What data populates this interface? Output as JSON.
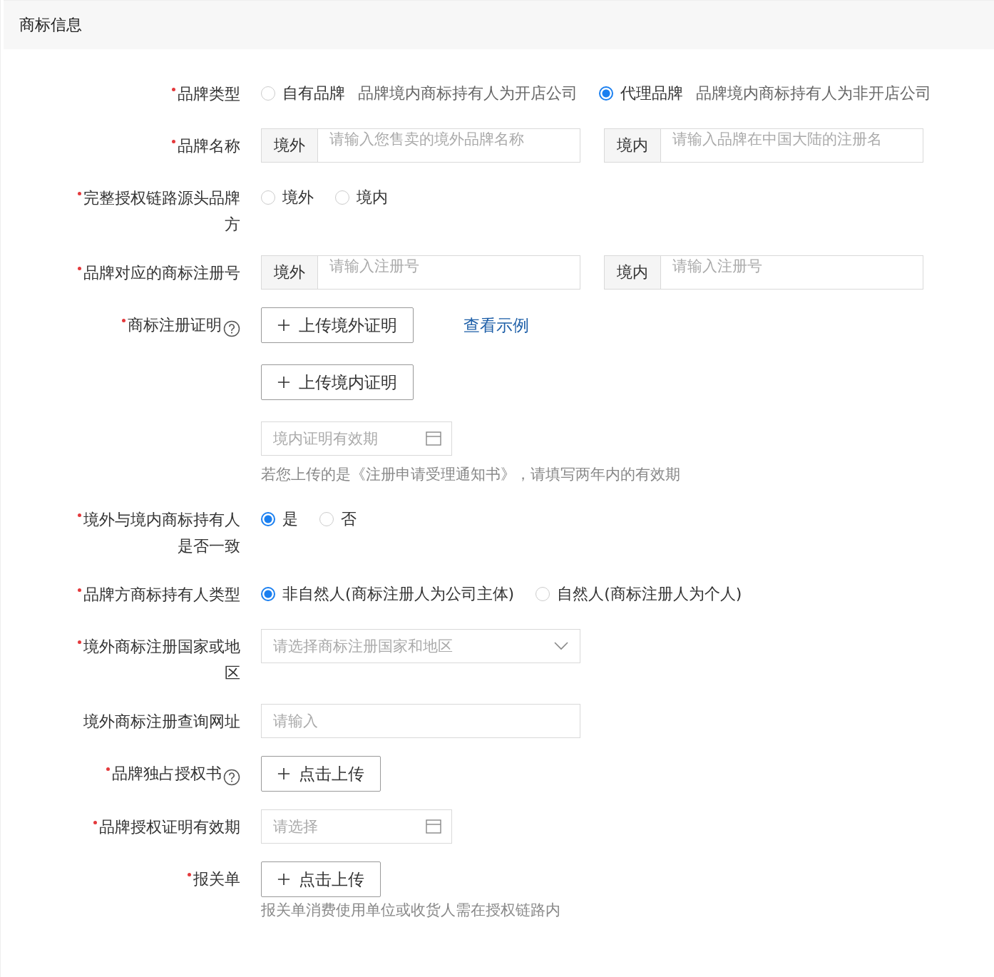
{
  "section_title": "商标信息",
  "fields": [
    {
      "label": "品牌类型",
      "required": true,
      "kind": "radio",
      "options": [
        {
          "label": "自有品牌",
          "description": "品牌境内商标持有人为开店公司",
          "selected": false
        },
        {
          "label": "代理品牌",
          "description": "品牌境内商标持有人为非开店公司",
          "selected": true
        }
      ]
    },
    {
      "label": "品牌名称",
      "required": true,
      "kind": "addon_inputs",
      "inputs": [
        {
          "addon": "境外",
          "placeholder": "请输入您售卖的境外品牌名称"
        },
        {
          "addon": "境内",
          "placeholder": "请输入品牌在中国大陆的注册名"
        }
      ]
    },
    {
      "label": "完整授权链路源头品牌方",
      "required": true,
      "kind": "radio",
      "options": [
        {
          "label": "境外",
          "selected": false
        },
        {
          "label": "境内",
          "selected": false
        }
      ]
    },
    {
      "label": "品牌对应的商标注册号",
      "required": true,
      "kind": "addon_inputs",
      "inputs": [
        {
          "addon": "境外",
          "placeholder": "请输入注册号"
        },
        {
          "addon": "境内",
          "placeholder": "请输入注册号"
        }
      ]
    },
    {
      "label": "商标注册证明",
      "required": true,
      "help": true,
      "kind": "upload",
      "uploads": [
        {
          "button": "上传境外证明",
          "link": "查看示例"
        },
        {
          "button": "上传境内证明"
        }
      ],
      "date": {
        "placeholder": "境内证明有效期"
      },
      "hint": "若您上传的是《注册申请受理通知书》，请填写两年内的有效期"
    },
    {
      "label": "境外与境内商标持有人是否一致",
      "required": true,
      "kind": "radio",
      "options": [
        {
          "label": "是",
          "selected": true
        },
        {
          "label": "否",
          "selected": false
        }
      ]
    },
    {
      "label": "品牌方商标持有人类型",
      "required": true,
      "kind": "radio",
      "options": [
        {
          "label": "非自然人(商标注册人为公司主体)",
          "selected": true
        },
        {
          "label": "自然人(商标注册人为个人)",
          "selected": false
        }
      ]
    },
    {
      "label": "境外商标注册国家或地区",
      "required": true,
      "kind": "select",
      "placeholder": "请选择商标注册国家和地区"
    },
    {
      "label": "境外商标注册查询网址",
      "required": false,
      "kind": "input",
      "placeholder": "请输入"
    },
    {
      "label": "品牌独占授权书",
      "required": true,
      "help": true,
      "kind": "upload",
      "uploads": [
        {
          "button": "点击上传"
        }
      ]
    },
    {
      "label": "品牌授权证明有效期",
      "required": true,
      "kind": "date",
      "placeholder": "请选择"
    },
    {
      "label": "报关单",
      "required": true,
      "kind": "upload",
      "uploads": [
        {
          "button": "点击上传"
        }
      ],
      "hint": "报关单消费使用单位或收货人需在授权链路内"
    }
  ]
}
